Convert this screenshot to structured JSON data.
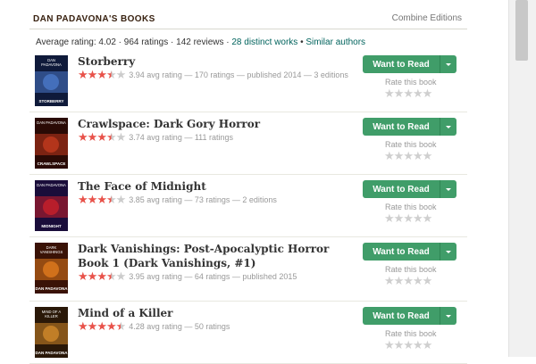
{
  "header": {
    "title": "DAN PADAVONA'S BOOKS",
    "combine_label": "Combine Editions"
  },
  "stats": {
    "text": "Average rating: 4.02 · 964 ratings · 142 reviews · ",
    "distinct_works": "28 distinct works",
    "separator": " • ",
    "similar_authors": "Similar authors"
  },
  "books": [
    {
      "title": "Storberry",
      "rating": 3.94,
      "meta": "3.94 avg rating — 170 ratings — published 2014 — 3 editions"
    },
    {
      "title": "Crawlspace: Dark Gory Horror",
      "rating": 3.74,
      "meta": "3.74 avg rating — 111 ratings"
    },
    {
      "title": "The Face of Midnight",
      "rating": 3.85,
      "meta": "3.85 avg rating — 73 ratings — 2 editions"
    },
    {
      "title": "Dark Vanishings: Post-Apocalyptic Horror Book 1 (Dark Vanishings, #1)",
      "rating": 3.95,
      "meta": "3.95 avg rating — 64 ratings — published 2015"
    },
    {
      "title": "Mind of a Killer",
      "rating": 4.28,
      "meta": "4.28 avg rating — 50 ratings"
    }
  ],
  "covers": [
    {
      "top": "DAN",
      "top2": "PADAVONA",
      "bottom": "STORBERRY",
      "bg": "#0f1a3a",
      "accent": "#4a78c8"
    },
    {
      "top": "DAN PADAVONA",
      "top2": "",
      "bottom": "CRAWLSPACE",
      "bg": "#2a0a05",
      "accent": "#c0391e"
    },
    {
      "top": "DAN PADAVONA",
      "top2": "",
      "bottom": "MIDNIGHT",
      "bg": "#1a0d3a",
      "accent": "#c8202a"
    },
    {
      "top": "DARK",
      "top2": "VANISHINGS",
      "bottom": "DAN PADAVONA",
      "bg": "#3a1206",
      "accent": "#e07a1e"
    },
    {
      "top": "MIND OF A",
      "top2": "KILLER",
      "bottom": "DAN PADAVONA",
      "bg": "#2a1808",
      "accent": "#d0882a"
    }
  ],
  "actions": {
    "want_label": "Want to Read",
    "rate_label": "Rate this book"
  },
  "colors": {
    "accent_green": "#409d69",
    "star_red": "#e8524a",
    "link": "#00635d"
  }
}
